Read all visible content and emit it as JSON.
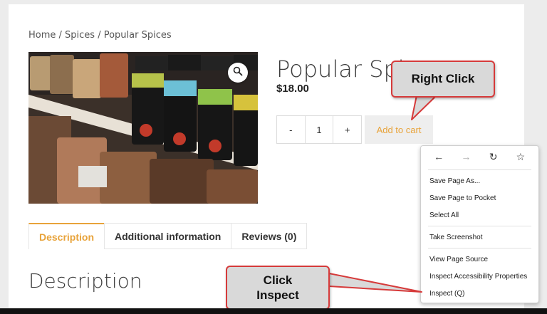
{
  "breadcrumb": "Home / Spices / Popular Spices",
  "product": {
    "title": "Popular Spices",
    "price": "$18.00",
    "qty_minus": "-",
    "qty_value": "1",
    "qty_plus": "+",
    "add_to_cart": "Add to cart"
  },
  "tabs": [
    {
      "label": "Description"
    },
    {
      "label": "Additional information"
    },
    {
      "label": "Reviews (0)"
    }
  ],
  "description_heading": "Description",
  "context_menu": {
    "nav_icons": [
      "back-icon",
      "forward-icon",
      "reload-icon",
      "bookmark-star-icon"
    ],
    "items": [
      {
        "label": "Save Page As..."
      },
      {
        "label": "Save Page to Pocket"
      },
      {
        "label": "Select All"
      },
      {
        "label": "Take Screenshot"
      },
      {
        "label": "View Page Source"
      },
      {
        "label": "Inspect Accessibility Properties"
      },
      {
        "label": "Inspect (Q)"
      }
    ]
  },
  "annotations": {
    "callout_right_click": "Right Click",
    "callout_click_inspect_line1": "Click",
    "callout_click_inspect_line2": "Inspect",
    "callout_color": "#d63a3a"
  },
  "colors": {
    "accent": "#e8a33a"
  }
}
